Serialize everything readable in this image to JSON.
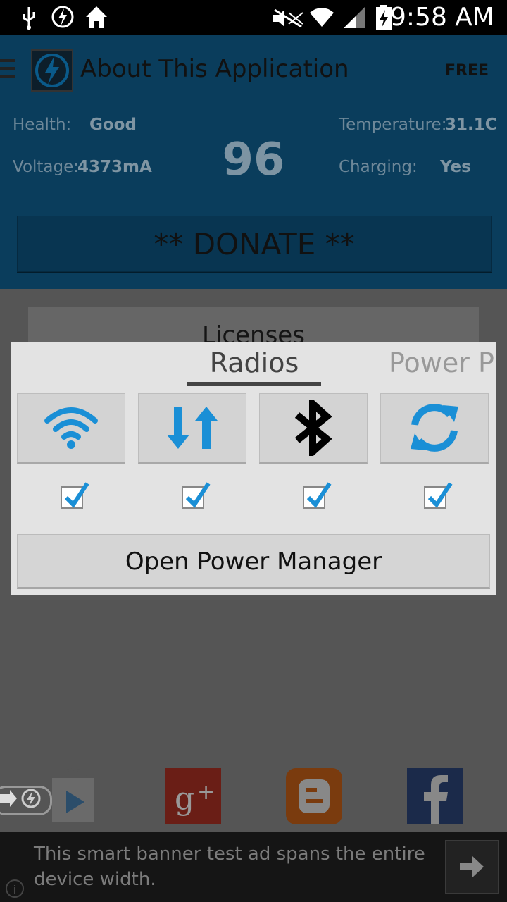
{
  "status_bar": {
    "time": "9:58 AM"
  },
  "app_bar": {
    "title": "About This Application",
    "badge": "FREE"
  },
  "battery": {
    "health_label": "Health:",
    "health_value": "Good",
    "voltage_label": "Voltage:",
    "voltage_value": "4373mA",
    "level": "96",
    "temperature_label": "Temperature:",
    "temperature_value": "31.1C",
    "charging_label": "Charging:",
    "charging_value": "Yes"
  },
  "donate_label": "** DONATE **",
  "licenses_label": "Licenses",
  "dialog": {
    "tabs": [
      "Radios",
      "Power Pl"
    ],
    "radios": [
      {
        "icon": "wifi-icon",
        "checked": true
      },
      {
        "icon": "mobile-data-icon",
        "checked": true
      },
      {
        "icon": "bluetooth-icon",
        "checked": true
      },
      {
        "icon": "sync-icon",
        "checked": true
      }
    ],
    "open_power_manager": "Open Power Manager"
  },
  "share_icons": [
    "play-store-icon",
    "google-plus-icon",
    "blogger-icon",
    "facebook-icon"
  ],
  "ad": {
    "text": "This smart banner test ad spans the entire device width."
  },
  "colors": {
    "accent": "#1a8fd6",
    "app_bar": "#0a3d5c"
  }
}
